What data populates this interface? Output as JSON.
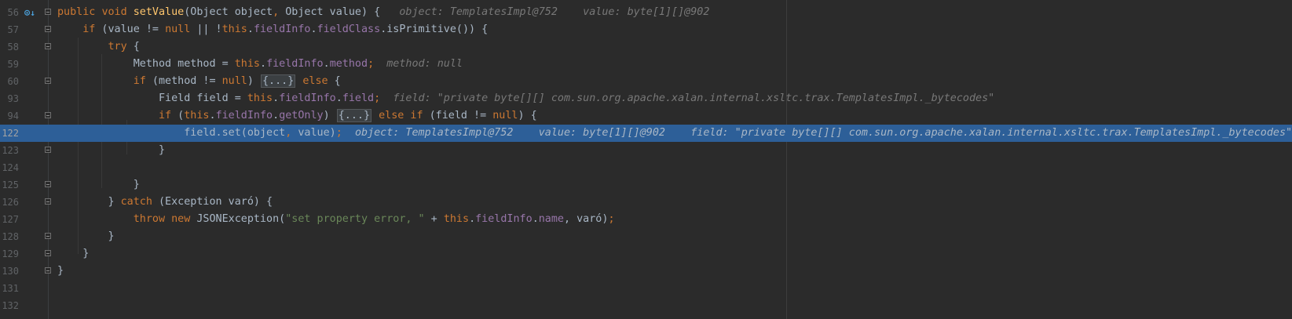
{
  "editor": {
    "lines": [
      {
        "num": "56",
        "t": {
          "a": "public",
          "b": "void",
          "c": "setValue",
          "d": "(Object object",
          "e": ",",
          "f": " Object value) {"
        },
        "hint": {
          "a": "object: TemplatesImpl@752",
          "b": "value: byte[1][]@902"
        }
      },
      {
        "num": "57",
        "t": {
          "a": "if",
          "b": " (value != ",
          "c": "null",
          "d": " || !",
          "e": "this",
          "f": ".",
          "g": "fieldInfo",
          "h": ".",
          "i": "fieldClass",
          "j": ".isPrimitive()) {"
        }
      },
      {
        "num": "58",
        "t": {
          "a": "try",
          "b": " {"
        }
      },
      {
        "num": "59",
        "t": {
          "a": "Method method = ",
          "b": "this",
          "c": ".",
          "d": "fieldInfo",
          "e": ".",
          "f": "method",
          "g": ";"
        },
        "hint": {
          "a": "method: null"
        }
      },
      {
        "num": "60",
        "t": {
          "a": "if",
          "b": " (method != ",
          "c": "null",
          "d": ") ",
          "e": "{...}",
          "f": " ",
          "g": "else",
          "h": " {"
        }
      },
      {
        "num": "93",
        "t": {
          "a": "Field field = ",
          "b": "this",
          "c": ".",
          "d": "fieldInfo",
          "e": ".",
          "f": "field",
          "g": ";"
        },
        "hint": {
          "a": "field: \"private byte[][] com.sun.org.apache.xalan.internal.xsltc.trax.TemplatesImpl._bytecodes\""
        }
      },
      {
        "num": "94",
        "t": {
          "a": "if",
          "b": " (",
          "c": "this",
          "d": ".",
          "e": "fieldInfo",
          "f": ".",
          "g": "getOnly",
          "h": ") ",
          "i": "{...}",
          "j": " ",
          "k": "else if",
          "l": " (field != ",
          "m": "null",
          "n": ") {"
        }
      },
      {
        "num": "122",
        "t": {
          "a": "field.set(object",
          "b": ",",
          "c": " value)",
          "d": ";"
        },
        "hint": {
          "a": "object: TemplatesImpl@752",
          "b": "value: byte[1][]@902",
          "c": "field: \"private byte[][] com.sun.org.apache.xalan.internal.xsltc.trax.TemplatesImpl._bytecodes\""
        }
      },
      {
        "num": "123",
        "t": {
          "a": "}"
        }
      },
      {
        "num": "124"
      },
      {
        "num": "125",
        "t": {
          "a": "}"
        }
      },
      {
        "num": "126",
        "t": {
          "a": "} ",
          "b": "catch",
          "c": " (Exception varó) {"
        }
      },
      {
        "num": "127",
        "t": {
          "a": "throw",
          "b": " ",
          "c": "new",
          "d": " JSONException(",
          "e": "\"set property error, \"",
          "f": " + ",
          "g": "this",
          "h": ".",
          "i": "fieldInfo",
          "j": ".",
          "k": "name",
          "l": ", varó)",
          "m": ";"
        }
      },
      {
        "num": "128",
        "t": {
          "a": "}"
        }
      },
      {
        "num": "129",
        "t": {
          "a": "}"
        }
      },
      {
        "num": "130",
        "t": {
          "a": "}"
        }
      },
      {
        "num": "131"
      },
      {
        "num": "132"
      }
    ]
  },
  "icons": {
    "breakpoint_override": "override-breakpoint-icon",
    "fold": "fold-marker-icon"
  },
  "colors": {
    "background": "#2b2b2b",
    "current_line": "#2d5f98",
    "keyword": "#cc7832",
    "method_decl": "#ffc66d",
    "field": "#9876aa",
    "string": "#6a8759",
    "plain": "#a9b7c6",
    "inline_hint": "#787878"
  }
}
